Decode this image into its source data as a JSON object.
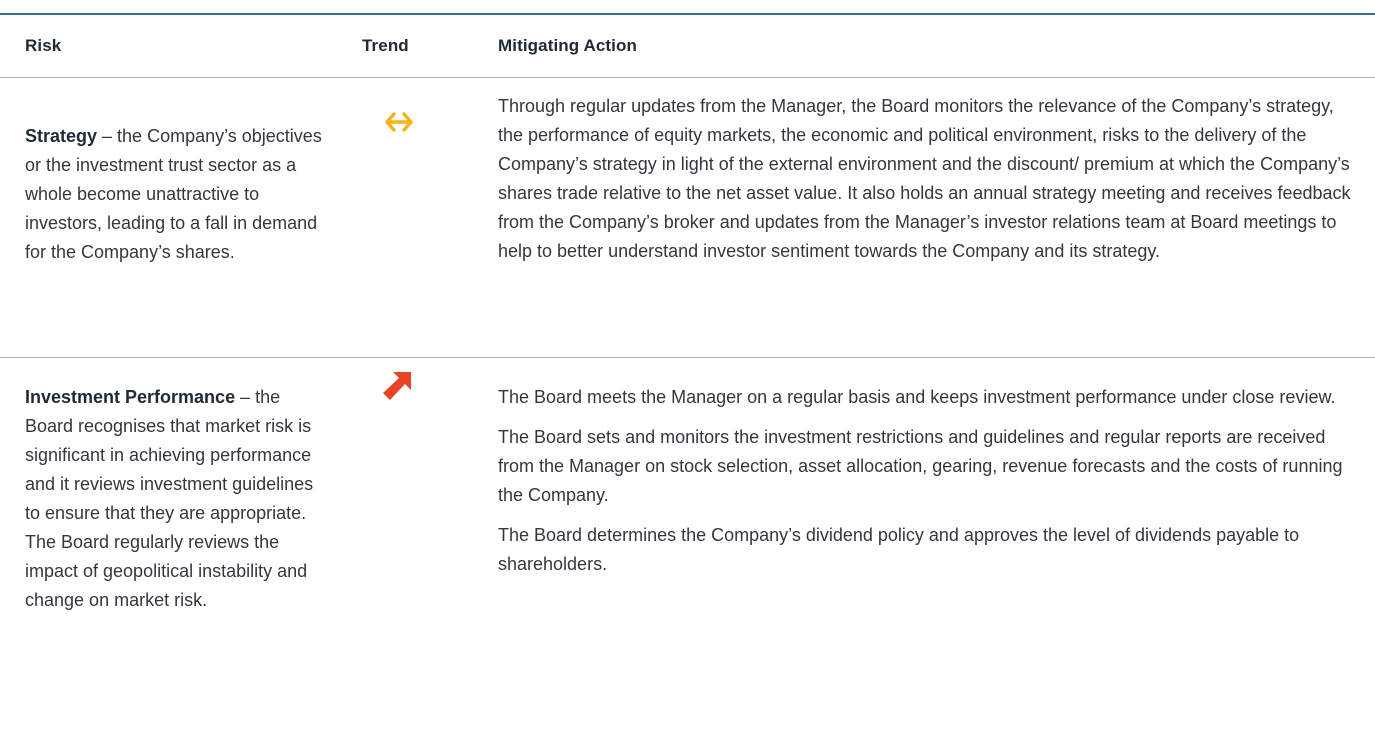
{
  "table": {
    "headers": {
      "risk": "Risk",
      "trend": "Trend",
      "action": "Mitigating Action"
    },
    "rows": [
      {
        "risk_name": "Strategy",
        "risk_text": " – the Company’s objectives or the investment trust sector as a whole become unattractive to investors, leading to a fall in demand for the Company’s shares.",
        "trend_icon": "horizontal-double-arrow-icon",
        "trend_color": "#f5b21b",
        "actions": [
          "Through regular updates from the Manager, the Board monitors the relevance of the Company’s strategy, the performance of equity markets, the economic and political environment, risks to the delivery of the Company’s strategy in light of the external environment and the discount/ premium at which the Company’s shares trade relative to the net asset value.  It also holds an annual strategy meeting and receives feedback from the Company’s broker and updates from the Manager’s investor relations team at Board meetings to help to better understand investor sentiment towards the Company and its strategy."
        ]
      },
      {
        "risk_name": "Investment Performance",
        "risk_text": " – the Board recognises that market risk is significant in achieving performance and it reviews investment guidelines to ensure that they are appropriate.  The Board regularly reviews the impact of geopolitical instability and change on market risk.",
        "trend_icon": "up-right-arrow-icon",
        "trend_color": "#ea4427",
        "actions": [
          "The Board meets the Manager on a regular basis and keeps investment performance under close review.",
          "The Board sets and monitors the investment restrictions and guidelines and regular reports are received from the Manager on stock selection, asset allocation, gearing, revenue forecasts and the costs of running the Company.",
          "The Board determines the Company’s dividend policy and approves the level of dividends payable to shareholders."
        ]
      }
    ]
  },
  "colors": {
    "rule_top": "#3f6b92",
    "rule_divider": "#a9bccc",
    "text": "#333740"
  }
}
